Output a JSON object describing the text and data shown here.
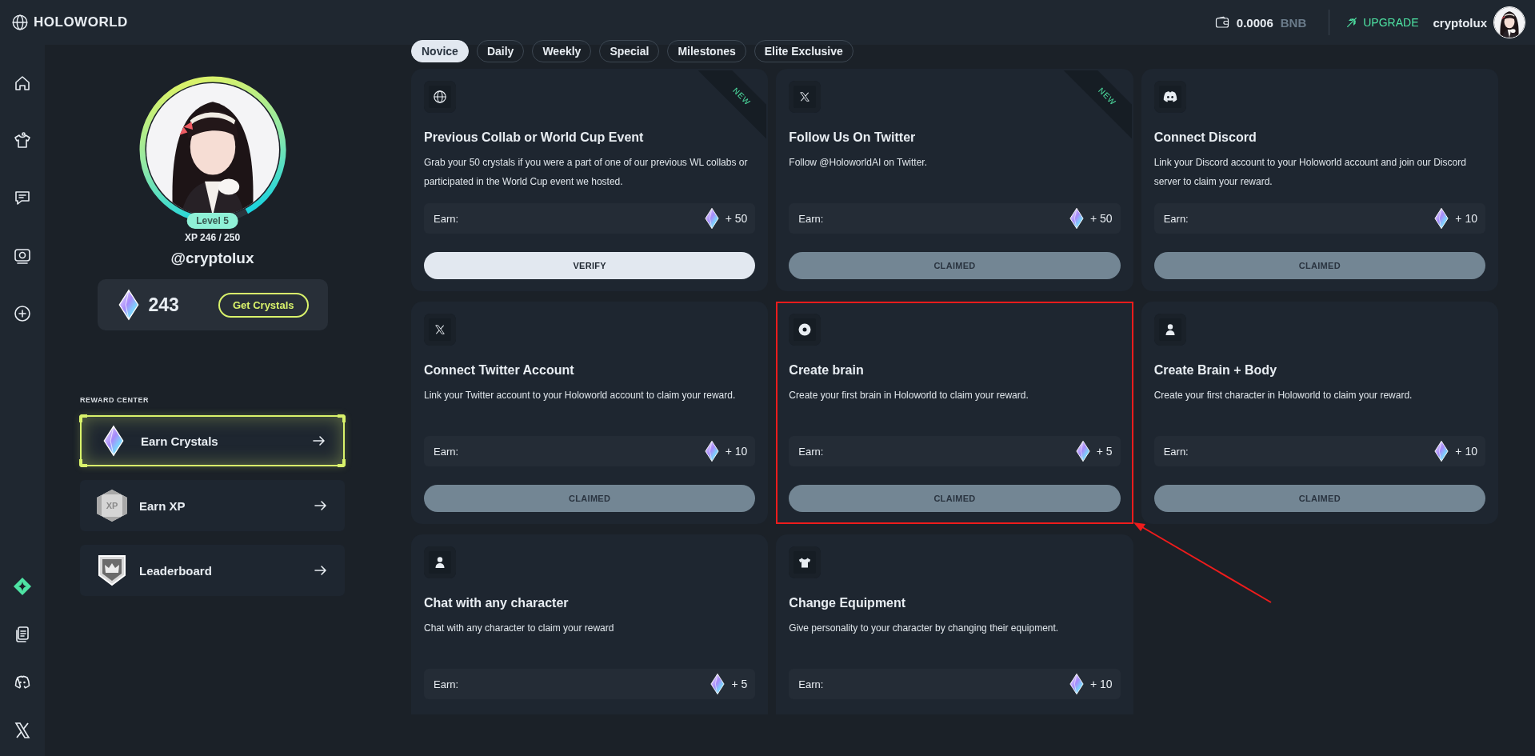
{
  "header": {
    "logo": "HOLOWORLD",
    "balance": "0.0006",
    "currency": "BNB",
    "upgrade": "UPGRADE",
    "username": "cryptolux"
  },
  "profile": {
    "xp_ring": {
      "level": 0.96
    },
    "level_badge": "Level 5",
    "xp": "XP 246 / 250",
    "handle": "@cryptolux",
    "crystals": "243",
    "get_button": "Get Crystals"
  },
  "reward_center": {
    "heading": "REWARD CENTER",
    "items": [
      {
        "label": "Earn Crystals",
        "kind": "crystal",
        "selected": true
      },
      {
        "label": "Earn XP",
        "kind": "xp",
        "badge": "XP",
        "selected": false
      },
      {
        "label": "Leaderboard",
        "kind": "crown",
        "selected": false
      }
    ]
  },
  "tabs": [
    {
      "label": "Novice",
      "selected": true
    },
    {
      "label": "Daily",
      "selected": false
    },
    {
      "label": "Weekly",
      "selected": false
    },
    {
      "label": "Special",
      "selected": false
    },
    {
      "label": "Milestones",
      "selected": false
    },
    {
      "label": "Elite Exclusive",
      "selected": false
    }
  ],
  "cards": [
    {
      "kind": "holoworld",
      "ribbon": "NEW",
      "title": "Previous Collab or World Cup Event",
      "description": "Grab your 50 crystals if you were a part of one of our previous WL collabs or participated in the World Cup event we hosted.",
      "earn_label": "Earn:",
      "reward": "+ 50",
      "button": "VERIFY",
      "claimed": false,
      "highlighted": false
    },
    {
      "kind": "x",
      "ribbon": "NEW",
      "title": "Follow Us On Twitter",
      "description": "Follow @HoloworldAI on Twitter.",
      "earn_label": "Earn:",
      "reward": "+ 50",
      "button": "CLAIMED",
      "claimed": true,
      "highlighted": false
    },
    {
      "kind": "discord",
      "title": "Connect Discord",
      "description": "Link your Discord account to your Holoworld account and join our Discord server to claim your reward.",
      "earn_label": "Earn:",
      "reward": "+ 10",
      "button": "CLAIMED",
      "claimed": true,
      "highlighted": false
    },
    {
      "kind": "x",
      "title": "Connect Twitter Account",
      "description": "Link your Twitter account to your Holoworld account to claim your reward.",
      "earn_label": "Earn:",
      "reward": "+ 10",
      "button": "CLAIMED",
      "claimed": true,
      "highlighted": false
    },
    {
      "kind": "brain",
      "title": "Create brain",
      "description": "Create your first brain in Holoworld to claim your reward.",
      "earn_label": "Earn:",
      "reward": "+ 5",
      "button": "CLAIMED",
      "claimed": true,
      "highlighted": true
    },
    {
      "kind": "person",
      "title": "Create Brain + Body",
      "description": "Create your first character in Holoworld to claim your reward.",
      "earn_label": "Earn:",
      "reward": "+ 10",
      "button": "CLAIMED",
      "claimed": true,
      "highlighted": false
    },
    {
      "kind": "person",
      "title": "Chat with any character",
      "description": "Chat with any character to claim your reward",
      "earn_label": "Earn:",
      "reward": "+ 5",
      "highlighted": false
    },
    {
      "kind": "shirt",
      "title": "Change Equipment",
      "description": "Give personality to your character by changing their equipment.",
      "earn_label": "Earn:",
      "reward": "+ 10",
      "highlighted": false
    }
  ]
}
